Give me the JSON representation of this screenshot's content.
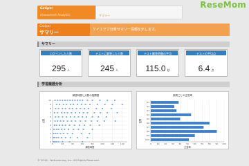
{
  "header": {
    "app_tab_label": "Catiper",
    "app_tab_sub": "Assessment Analytics",
    "summary_tab_label": "サマリー",
    "logo_text": "ReseMom"
  },
  "banner": {
    "app_name": "Catiper",
    "page_title": "サマリー",
    "description": "ケイエアブ分析サマリー情報を示します。"
  },
  "sections": {
    "summary": "サマリー",
    "analysis": "学習履歴分析"
  },
  "stats": [
    {
      "label": "ログインした人数",
      "value": "295",
      "unit": "人"
    },
    {
      "label": "テストに解答した人数",
      "value": "245",
      "unit": "人"
    },
    {
      "label": "テスト解答時間の平均",
      "value": "115.0",
      "unit": "秒"
    },
    {
      "label": "テストの平均点",
      "value": "6.4",
      "unit": "点"
    }
  ],
  "charts": {
    "scatter_title": "解答時間と点数の相関図",
    "bar_title": "設問ごとの正答率"
  },
  "chart_data": [
    {
      "type": "scatter",
      "title": "解答時間と点数の相関図",
      "xlabel": "解答時間",
      "ylabel": "点数",
      "xlim": [
        0,
        150
      ],
      "ylim": [
        0,
        10
      ],
      "x_ticks": [
        "0",
        "20",
        "40",
        "60",
        "80",
        "100",
        "120",
        "140"
      ],
      "y_ticks": [
        "0",
        "1",
        "2",
        "3",
        "4",
        "5",
        "6",
        "7",
        "8",
        "9",
        "10"
      ],
      "color": "#3a7fd0",
      "points": [
        [
          5,
          10
        ],
        [
          10,
          10
        ],
        [
          15,
          10
        ],
        [
          20,
          10
        ],
        [
          25,
          10
        ],
        [
          30,
          10
        ],
        [
          35,
          10
        ],
        [
          40,
          10
        ],
        [
          45,
          10
        ],
        [
          50,
          10
        ],
        [
          55,
          10
        ],
        [
          60,
          10
        ],
        [
          70,
          10
        ],
        [
          80,
          10
        ],
        [
          95,
          10
        ],
        [
          110,
          10
        ],
        [
          125,
          10
        ],
        [
          8,
          9
        ],
        [
          14,
          9
        ],
        [
          22,
          9
        ],
        [
          28,
          9
        ],
        [
          36,
          9
        ],
        [
          42,
          9
        ],
        [
          50,
          9
        ],
        [
          58,
          9
        ],
        [
          66,
          9
        ],
        [
          75,
          9
        ],
        [
          90,
          9
        ],
        [
          105,
          9
        ],
        [
          120,
          9
        ],
        [
          140,
          9
        ],
        [
          6,
          8
        ],
        [
          12,
          8
        ],
        [
          20,
          8
        ],
        [
          26,
          8
        ],
        [
          34,
          8
        ],
        [
          40,
          8
        ],
        [
          48,
          8
        ],
        [
          56,
          8
        ],
        [
          64,
          8
        ],
        [
          72,
          8
        ],
        [
          88,
          8
        ],
        [
          100,
          8
        ],
        [
          118,
          8
        ],
        [
          4,
          7
        ],
        [
          10,
          7
        ],
        [
          18,
          7
        ],
        [
          24,
          7
        ],
        [
          30,
          7
        ],
        [
          38,
          7
        ],
        [
          46,
          7
        ],
        [
          54,
          7
        ],
        [
          62,
          7
        ],
        [
          70,
          7
        ],
        [
          84,
          7
        ],
        [
          96,
          7
        ],
        [
          110,
          7
        ],
        [
          130,
          7
        ],
        [
          6,
          6
        ],
        [
          12,
          6
        ],
        [
          20,
          6
        ],
        [
          28,
          6
        ],
        [
          36,
          6
        ],
        [
          44,
          6
        ],
        [
          52,
          6
        ],
        [
          60,
          6
        ],
        [
          68,
          6
        ],
        [
          80,
          6
        ],
        [
          92,
          6
        ],
        [
          108,
          6
        ],
        [
          5,
          5
        ],
        [
          10,
          5
        ],
        [
          16,
          5
        ],
        [
          22,
          5
        ],
        [
          30,
          5
        ],
        [
          38,
          5
        ],
        [
          46,
          5
        ],
        [
          56,
          5
        ],
        [
          66,
          5
        ],
        [
          78,
          5
        ],
        [
          90,
          5
        ],
        [
          104,
          5
        ],
        [
          126,
          5
        ],
        [
          4,
          4
        ],
        [
          8,
          4
        ],
        [
          14,
          4
        ],
        [
          20,
          4
        ],
        [
          26,
          4
        ],
        [
          34,
          4
        ],
        [
          44,
          4
        ],
        [
          54,
          4
        ],
        [
          64,
          4
        ],
        [
          76,
          4
        ],
        [
          94,
          4
        ],
        [
          3,
          3
        ],
        [
          8,
          3
        ],
        [
          12,
          3
        ],
        [
          18,
          3
        ],
        [
          24,
          3
        ],
        [
          32,
          3
        ],
        [
          42,
          3
        ],
        [
          52,
          3
        ],
        [
          62,
          3
        ],
        [
          80,
          3
        ],
        [
          2,
          2
        ],
        [
          6,
          2
        ],
        [
          10,
          2
        ],
        [
          16,
          2
        ],
        [
          22,
          2
        ],
        [
          30,
          2
        ],
        [
          40,
          2
        ],
        [
          58,
          2
        ],
        [
          74,
          2
        ],
        [
          2,
          1
        ],
        [
          4,
          1
        ],
        [
          8,
          1
        ],
        [
          12,
          1
        ],
        [
          18,
          1
        ],
        [
          26,
          1
        ],
        [
          36,
          1
        ],
        [
          50,
          1
        ],
        [
          70,
          1
        ],
        [
          1,
          0
        ],
        [
          3,
          0
        ],
        [
          5,
          0
        ],
        [
          8,
          0
        ],
        [
          12,
          0
        ],
        [
          20,
          0
        ],
        [
          34,
          0
        ],
        [
          60,
          0
        ]
      ]
    },
    {
      "type": "bar",
      "orientation": "horizontal",
      "title": "設問ごとの正答率",
      "xlabel": "正答率",
      "ylabel": "設問",
      "xlim": [
        0,
        100
      ],
      "x_ticks": [
        "0",
        "10",
        "20",
        "30",
        "40",
        "50",
        "60",
        "70",
        "80",
        "90",
        "100"
      ],
      "categories": [
        "Q1",
        "Q2",
        "Q3",
        "Q4",
        "Q5",
        "Q6",
        "Q7",
        "Q8",
        "Q9",
        "Q10"
      ],
      "values": [
        38,
        32,
        35,
        55,
        40,
        80,
        72,
        90,
        60,
        52
      ],
      "color": "#3a7fd0"
    }
  ],
  "footer": "© 2016 - NetLearning, Inc. All Rights Reserved."
}
